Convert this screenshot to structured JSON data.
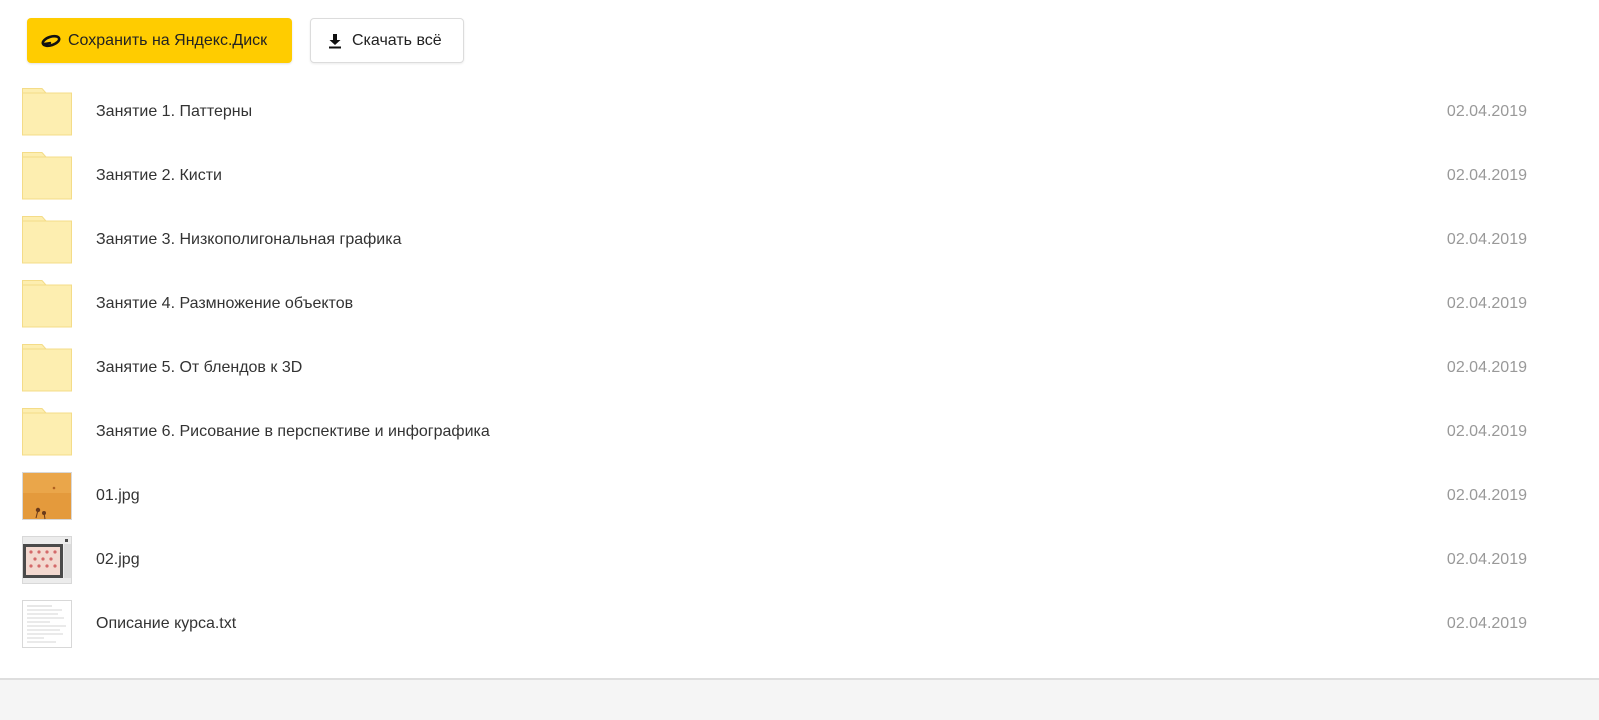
{
  "toolbar": {
    "save_label": "Сохранить на Яндекс.Диск",
    "save_icon": "yandex-disk-icon",
    "download_label": "Скачать всё",
    "download_icon": "download-icon",
    "accent_color": "#ffcc00"
  },
  "files": [
    {
      "name": "Занятие 1. Паттерны",
      "date": "02.04.2019",
      "type": "folder"
    },
    {
      "name": "Занятие 2. Кисти",
      "date": "02.04.2019",
      "type": "folder"
    },
    {
      "name": "Занятие 3. Низкополигональная графика",
      "date": "02.04.2019",
      "type": "folder"
    },
    {
      "name": "Занятие 4. Размножение объектов",
      "date": "02.04.2019",
      "type": "folder"
    },
    {
      "name": "Занятие 5. От блендов к 3D",
      "date": "02.04.2019",
      "type": "folder"
    },
    {
      "name": "Занятие 6. Рисование в перспективе и инфографика",
      "date": "02.04.2019",
      "type": "folder"
    },
    {
      "name": "01.jpg",
      "date": "02.04.2019",
      "type": "image"
    },
    {
      "name": "02.jpg",
      "date": "02.04.2019",
      "type": "image"
    },
    {
      "name": "Описание курса.txt",
      "date": "02.04.2019",
      "type": "text"
    }
  ]
}
